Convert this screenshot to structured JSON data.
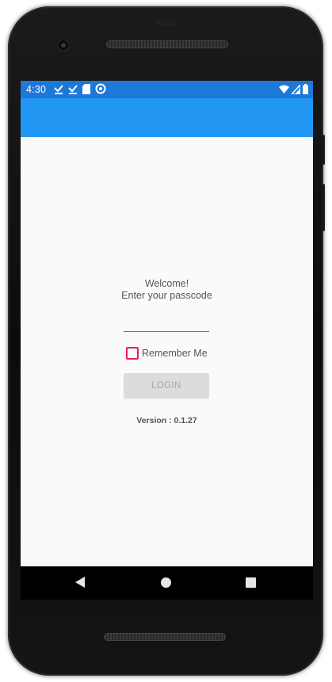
{
  "status_bar": {
    "time": "4:30",
    "left_icons": [
      "download-done-icon",
      "download-done-icon",
      "sd-card-icon",
      "sync-icon"
    ],
    "right_icons": [
      "wifi-icon",
      "cell-signal-icon",
      "battery-icon"
    ],
    "color": "#1e78d8"
  },
  "app_bar": {
    "color": "#2196f3"
  },
  "login": {
    "welcome_line1": "Welcome!",
    "welcome_line2": "Enter your passcode",
    "passcode_value": "",
    "remember_label": "Remember Me",
    "remember_checked": false,
    "checkbox_color": "#e91e63",
    "login_label": "LOGIN",
    "version": "Version : 0.1.27"
  },
  "nav_bar": {
    "icons": [
      "back-icon",
      "home-icon",
      "recents-icon"
    ]
  }
}
